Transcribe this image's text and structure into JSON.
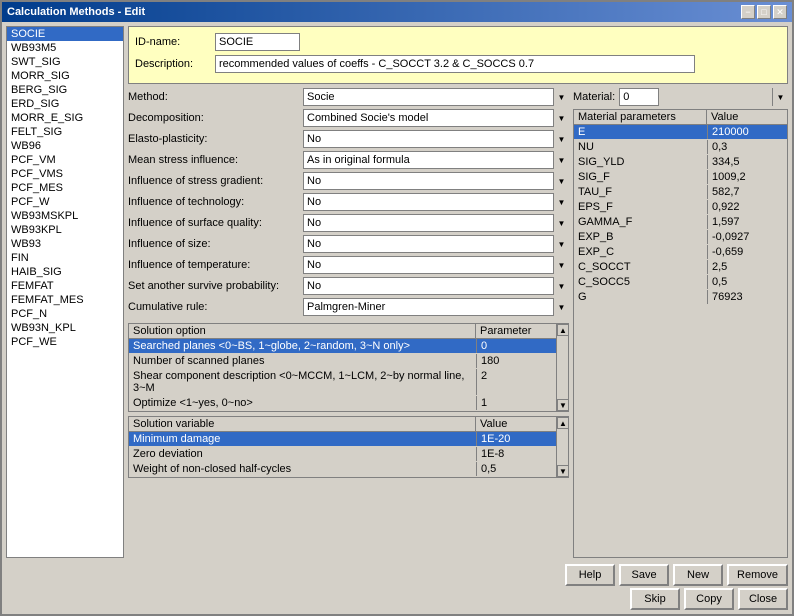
{
  "window": {
    "title": "Calculation Methods - Edit",
    "min_btn": "−",
    "max_btn": "□",
    "close_btn": "✕"
  },
  "left_panel": {
    "items": [
      {
        "label": "SOCIE",
        "selected": true
      },
      {
        "label": "WB93M5",
        "selected": false
      },
      {
        "label": "SWT_SIG",
        "selected": false
      },
      {
        "label": "MORR_SIG",
        "selected": false
      },
      {
        "label": "BERG_SIG",
        "selected": false
      },
      {
        "label": "ERD_SIG",
        "selected": false
      },
      {
        "label": "MORR_E_SIG",
        "selected": false
      },
      {
        "label": "FELT_SIG",
        "selected": false
      },
      {
        "label": "WB96",
        "selected": false
      },
      {
        "label": "PCF_VM",
        "selected": false
      },
      {
        "label": "PCF_VMS",
        "selected": false
      },
      {
        "label": "PCF_MES",
        "selected": false
      },
      {
        "label": "PCF_W",
        "selected": false
      },
      {
        "label": "WB93MSKPL",
        "selected": false
      },
      {
        "label": "WB93KPL",
        "selected": false
      },
      {
        "label": "WB93",
        "selected": false
      },
      {
        "label": "FIN",
        "selected": false
      },
      {
        "label": "HAIB_SIG",
        "selected": false
      },
      {
        "label": "FEMFAT",
        "selected": false
      },
      {
        "label": "FEMFAT_MES",
        "selected": false
      },
      {
        "label": "PCF_N",
        "selected": false
      },
      {
        "label": "WB93N_KPL",
        "selected": false
      },
      {
        "label": "PCF_WE",
        "selected": false
      }
    ]
  },
  "form": {
    "id_label": "ID-name:",
    "id_value": "SOCIE",
    "desc_label": "Description:",
    "desc_value": "recommended values of coeffs - C_SOCCT 3.2 & C_SOCCS 0.7"
  },
  "method_params": {
    "method_label": "Method:",
    "method_value": "Socie",
    "decomposition_label": "Decomposition:",
    "decomposition_value": "Combined Socie's model",
    "elasto_label": "Elasto-plasticity:",
    "elasto_value": "No",
    "mean_stress_label": "Mean stress influence:",
    "mean_stress_value": "As in original formula",
    "stress_gradient_label": "Influence of stress gradient:",
    "stress_gradient_value": "No",
    "technology_label": "Influence of technology:",
    "technology_value": "No",
    "surface_label": "Influence of surface quality:",
    "surface_value": "No",
    "size_label": "Influence of size:",
    "size_value": "No",
    "temperature_label": "Influence of temperature:",
    "temperature_value": "No",
    "survive_label": "Set another survive probability:",
    "survive_value": "No",
    "cumulative_label": "Cumulative rule:",
    "cumulative_value": "Palmgren-Miner"
  },
  "solution_options": {
    "header_option": "Solution option",
    "header_param": "Parameter",
    "rows": [
      {
        "option": "Searched planes <0~BS, 1~globe, 2~random, 3~N only>",
        "param": "0",
        "selected": true
      },
      {
        "option": "Number of scanned planes",
        "param": "180",
        "selected": false
      },
      {
        "option": "Shear component description <0~MCCM, 1~LCM, 2~by normal line, 3~M",
        "param": "2",
        "selected": false
      },
      {
        "option": "Optimize <1~yes, 0~no>",
        "param": "1",
        "selected": false
      }
    ]
  },
  "solution_variable": {
    "header_variable": "Solution variable",
    "header_value": "Value",
    "rows": [
      {
        "variable": "Minimum damage",
        "value": "1E-20",
        "selected": true
      },
      {
        "variable": "Zero deviation",
        "value": "1E-8",
        "selected": false
      },
      {
        "variable": "Weight of non-closed half-cycles",
        "value": "0,5",
        "selected": false
      }
    ]
  },
  "material": {
    "label": "Material:",
    "value": "0",
    "header_param": "Material parameters",
    "header_value": "Value",
    "rows": [
      {
        "param": "E",
        "value": "210000",
        "selected": true
      },
      {
        "param": "NU",
        "value": "0,3",
        "selected": false
      },
      {
        "param": "SIG_YLD",
        "value": "334,5",
        "selected": false
      },
      {
        "param": "SIG_F",
        "value": "1009,2",
        "selected": false
      },
      {
        "param": "TAU_F",
        "value": "582,7",
        "selected": false
      },
      {
        "param": "EPS_F",
        "value": "0,922",
        "selected": false
      },
      {
        "param": "GAMMA_F",
        "value": "1,597",
        "selected": false
      },
      {
        "param": "EXP_B",
        "value": "-0,0927",
        "selected": false
      },
      {
        "param": "EXP_C",
        "value": "-0,659",
        "selected": false
      },
      {
        "param": "C_SOCCT",
        "value": "2,5",
        "selected": false
      },
      {
        "param": "C_SOCC5",
        "value": "0,5",
        "selected": false
      },
      {
        "param": "G",
        "value": "76923",
        "selected": false
      }
    ]
  },
  "buttons_row1": {
    "help": "Help",
    "save": "Save",
    "new": "New",
    "remove": "Remove"
  },
  "buttons_row2": {
    "skip": "Skip",
    "copy": "Copy",
    "close": "Close"
  }
}
